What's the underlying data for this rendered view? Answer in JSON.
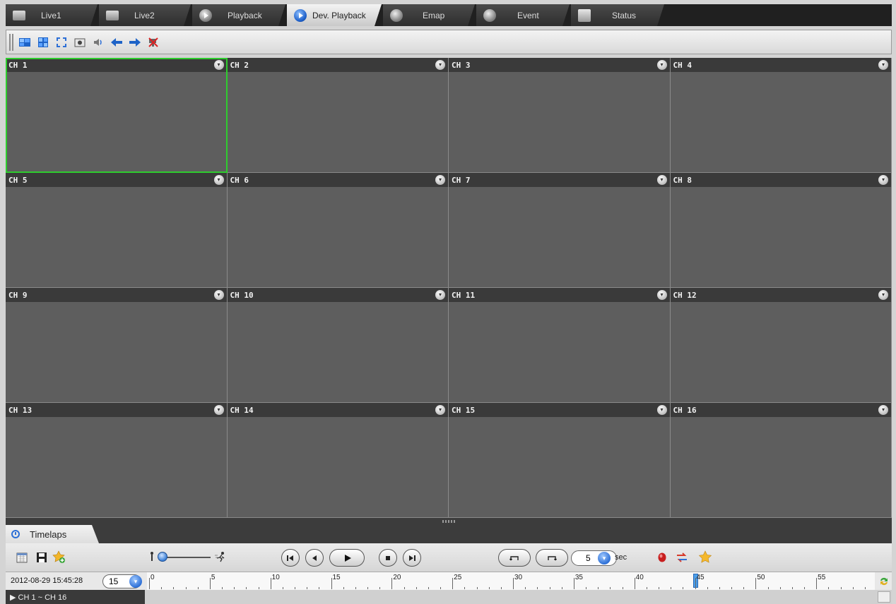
{
  "tabs": [
    {
      "label": "Live1",
      "icon": "monitor-icon"
    },
    {
      "label": "Live2",
      "icon": "monitor-icon"
    },
    {
      "label": "Playback",
      "icon": "playback-icon"
    },
    {
      "label": "Dev. Playback",
      "icon": "device-playback-icon",
      "active": true
    },
    {
      "label": "Emap",
      "icon": "globe-icon"
    },
    {
      "label": "Event",
      "icon": "alarm-icon"
    },
    {
      "label": "Status",
      "icon": "status-note-icon"
    }
  ],
  "toolbar": {
    "tools": [
      "layout-16x9-icon",
      "layout-4x3-icon",
      "fullscreen-icon",
      "snapshot-icon",
      "audio-icon",
      "arrow-left-icon",
      "arrow-right-icon",
      "disconnect-icon"
    ]
  },
  "channels": [
    "CH 1",
    "CH 2",
    "CH 3",
    "CH 4",
    "CH 5",
    "CH 6",
    "CH 7",
    "CH 8",
    "CH 9",
    "CH 10",
    "CH 11",
    "CH 12",
    "CH 13",
    "CH 14",
    "CH 15",
    "CH 16"
  ],
  "selected_channel": "CH 1",
  "bottom": {
    "tab_label": "Timelaps",
    "step_value": "5",
    "step_unit": "sec",
    "datetime": "2012-08-29 15:45:28",
    "zoom_value": "15",
    "timeline_labels": [
      "0",
      "5",
      "10",
      "15",
      "20",
      "25",
      "30",
      "35",
      "40",
      "45",
      "50",
      "55"
    ],
    "cursor_position_minute": 45,
    "channel_range": "▶ CH 1 ~ CH 16"
  },
  "colors": {
    "selected_outline": "#2ecc2e",
    "accent_blue": "#2d6fd6"
  }
}
